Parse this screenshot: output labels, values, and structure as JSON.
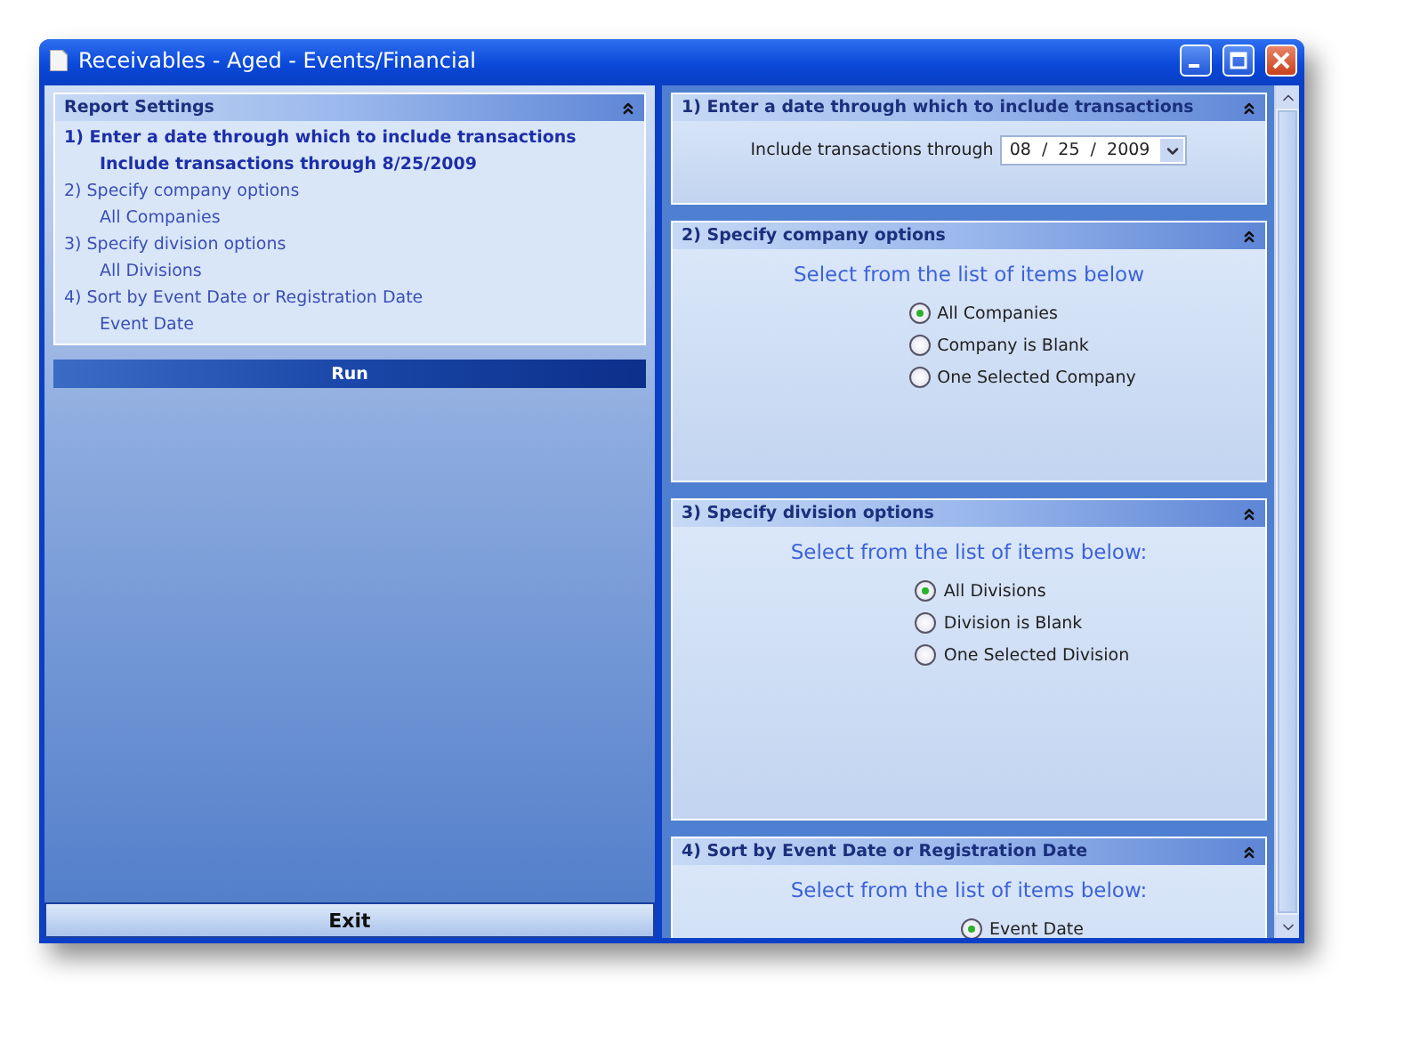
{
  "window": {
    "title": "Receivables - Aged - Events/Financial"
  },
  "report_settings": {
    "title": "Report Settings",
    "steps": [
      {
        "heading": "1)  Enter a date through which to include transactions",
        "value": "Include transactions through  8/25/2009",
        "selected": true
      },
      {
        "heading": "2) Specify company options",
        "value": "All Companies",
        "selected": false
      },
      {
        "heading": "3) Specify division options",
        "value": "All Divisions",
        "selected": false
      },
      {
        "heading": "4)  Sort by Event Date or Registration Date",
        "value": "Event Date",
        "selected": false
      }
    ]
  },
  "run_button": "Run",
  "exit_button": {
    "label": "Exit"
  },
  "sections": [
    {
      "kind": "date",
      "title": "1)  Enter a date through which to include transactions",
      "label": "Include transactions through",
      "date": "08  /  25  /  2009"
    },
    {
      "kind": "options",
      "title": "2)  Specify company options",
      "prompt": "Select from the list of items below",
      "options": [
        {
          "label": "All Companies",
          "selected": true
        },
        {
          "label": "Company is Blank",
          "selected": false
        },
        {
          "label": "One Selected Company",
          "selected": false
        }
      ]
    },
    {
      "kind": "options",
      "title": "3)  Specify division options",
      "prompt": "Select from the list of items below:",
      "options": [
        {
          "label": "All Divisions",
          "selected": true
        },
        {
          "label": "Division is Blank",
          "selected": false
        },
        {
          "label": "One Selected Division",
          "selected": false
        }
      ]
    },
    {
      "kind": "options",
      "title": "4)  Sort by Event Date or Registration Date",
      "prompt": "Select from the list of items below:",
      "options": [
        {
          "label": "Event Date",
          "selected": true
        }
      ]
    }
  ]
}
